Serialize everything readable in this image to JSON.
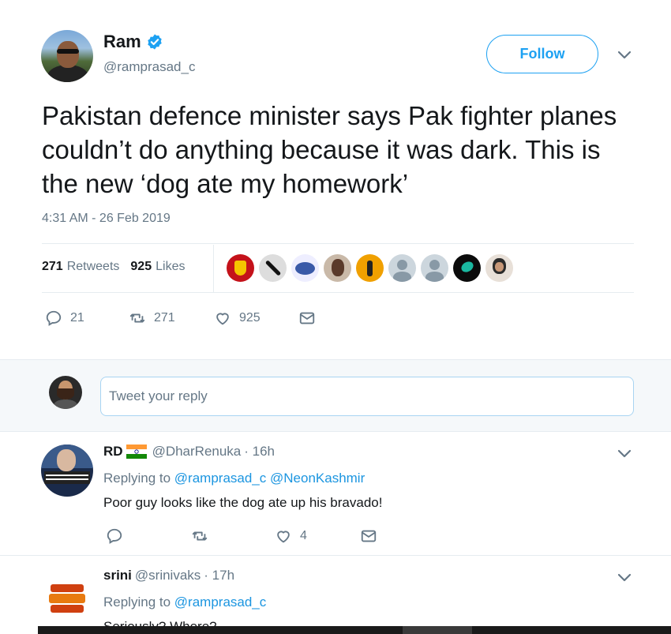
{
  "tweet": {
    "author_name": "Ram",
    "author_handle": "@ramprasad_c",
    "follow_label": "Follow",
    "text": "Pakistan defence minister says Pak fighter planes couldn’t do anything because it was dark. This is the new ‘dog ate my homework’",
    "timestamp": "4:31 AM - 26 Feb 2019",
    "stats": {
      "retweets_count": "271",
      "retweets_label": "Retweets",
      "likes_count": "925",
      "likes_label": "Likes"
    },
    "actions": {
      "reply_count": "21",
      "retweet_count": "271",
      "like_count": "925"
    }
  },
  "reply_box": {
    "placeholder": "Tweet your reply"
  },
  "replies": [
    {
      "name": "RD",
      "handle": "@DharRenuka",
      "time": "· 16h",
      "replying_label": "Replying to",
      "mentions": [
        "@ramprasad_c",
        "@NeonKashmir"
      ],
      "text": "Poor guy looks like the dog ate up his bravado!",
      "reply_count": "",
      "retweet_count": "",
      "like_count": "4"
    },
    {
      "name": "srini",
      "handle": "@srinivaks",
      "time": "· 17h",
      "replying_label": "Replying to",
      "mentions": [
        "@ramprasad_c"
      ],
      "text": "Seriously? Where?"
    }
  ],
  "colors": {
    "accent": "#1da1f2",
    "mention": "#1b95e0",
    "muted": "#657786",
    "text": "#14171a",
    "like_heart": "#657786"
  },
  "icons": {
    "verified": "verified-badge-icon",
    "reply": "reply-bubble-icon",
    "retweet": "retweet-icon",
    "like": "heart-icon",
    "dm": "envelope-icon",
    "more": "chevron-down-icon"
  }
}
